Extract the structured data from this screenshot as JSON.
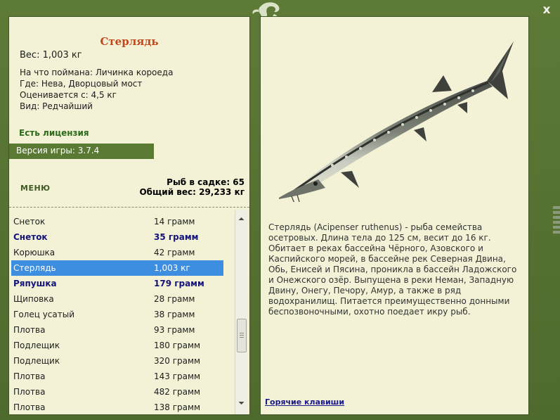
{
  "window": {
    "close_label": "x"
  },
  "fish": {
    "name": "Стерлядь",
    "weight": "Вес: 1,003 кг",
    "caught_with": "На что поймана: Личинка короеда",
    "location": "Где: Нева, Дворцовый мост",
    "valued": "Оценивается с: 4,5 кг",
    "rarity": "Вид: Редчайший",
    "description": "Стерлядь (Acipenser ruthenus) - рыба семейства осетровых. Длина тела до 125 см, весит до 16 кг. Обитает в реках бассейна Чёрного, Азовского и Каспийского морей, в бассейне рек Северная Двина, Обь, Енисей и Пясина, проникла в бассейн Ладожского и Онежского озёр. Выпущена в реки Неман, Западную Двину, Онегу, Печору, Амур, а также в ряд водохранилищ. Питается преимущественно донными беспозвоночными, охотно поедает икру рыб."
  },
  "license": "Есть лицензия",
  "version": "Версия игры: 3.7.4",
  "menu_label": "МЕНЮ",
  "stats": {
    "fish_count": "Рыб в садке: 65",
    "total_weight": "Общий вес: 29,233 кг"
  },
  "hotkeys_label": "Горячие клавиши",
  "catch_list": [
    {
      "name": "Снеток",
      "weight": "14 грамм",
      "bold": false,
      "selected": false
    },
    {
      "name": "Снеток",
      "weight": "35 грамм",
      "bold": true,
      "selected": false
    },
    {
      "name": "Корюшка",
      "weight": "42 грамм",
      "bold": false,
      "selected": false
    },
    {
      "name": "Стерлядь",
      "weight": "1,003 кг",
      "bold": false,
      "selected": true
    },
    {
      "name": "Ряпушка",
      "weight": "179 грамм",
      "bold": true,
      "selected": false
    },
    {
      "name": "Щиповка",
      "weight": "28 грамм",
      "bold": false,
      "selected": false
    },
    {
      "name": "Голец усатый",
      "weight": "38 грамм",
      "bold": false,
      "selected": false
    },
    {
      "name": "Плотва",
      "weight": "93 грамм",
      "bold": false,
      "selected": false
    },
    {
      "name": "Подлещик",
      "weight": "180 грамм",
      "bold": false,
      "selected": false
    },
    {
      "name": "Подлещик",
      "weight": "320 грамм",
      "bold": false,
      "selected": false
    },
    {
      "name": "Плотва",
      "weight": "143 грамм",
      "bold": false,
      "selected": false
    },
    {
      "name": "Плотва",
      "weight": "482 грамм",
      "bold": false,
      "selected": false
    },
    {
      "name": "Плотва",
      "weight": "138 грамм",
      "bold": false,
      "selected": false
    }
  ],
  "colors": {
    "frame": "#567232",
    "panel": "#f3f2d6",
    "title": "#c0471b",
    "license": "#2d6b1a",
    "selection": "#3d8ee0",
    "rare_text": "#14147a"
  }
}
